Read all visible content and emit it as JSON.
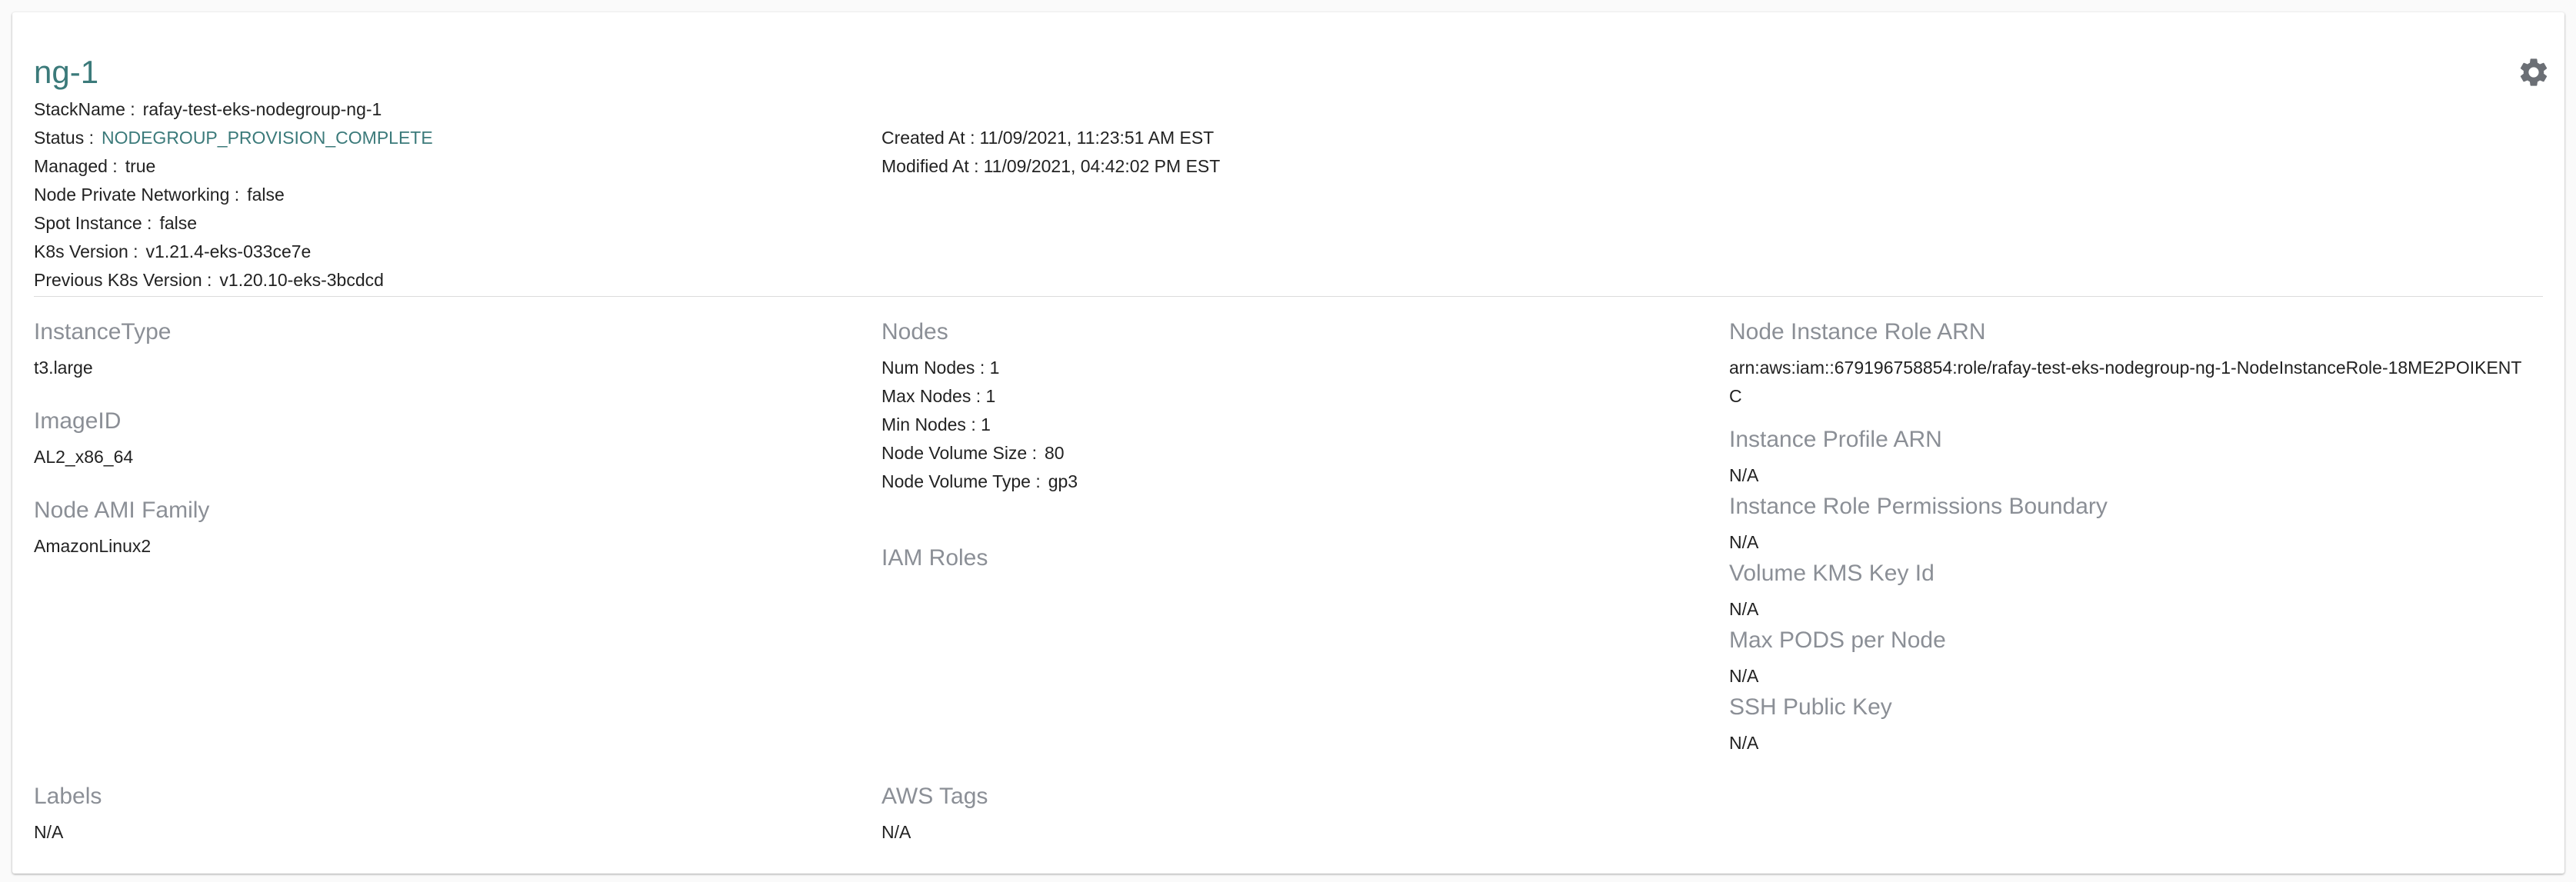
{
  "nodegroup": {
    "name": "ng-1",
    "settings_icon": "gear-icon"
  },
  "info": {
    "stack_name": {
      "label": "StackName :",
      "value": "rafay-test-eks-nodegroup-ng-1"
    },
    "status": {
      "label": "Status :",
      "value": "NODEGROUP_PROVISION_COMPLETE",
      "color": "#3b7a7a"
    },
    "managed": {
      "label": "Managed :",
      "value": "true"
    },
    "node_private_networking": {
      "label": "Node Private Networking :",
      "value": "false"
    },
    "spot_instance": {
      "label": "Spot Instance :",
      "value": "false"
    },
    "k8s_version": {
      "label": "K8s Version :",
      "value": "v1.21.4-eks-033ce7e"
    },
    "previous_k8s_version": {
      "label": "Previous K8s Version :",
      "value": "v1.20.10-eks-3bcdcd"
    },
    "created_at": {
      "label": "Created At :",
      "value": "11/09/2021, 11:23:51 AM EST"
    },
    "modified_at": {
      "label": "Modified At :",
      "value": "11/09/2021, 04:42:02 PM EST"
    }
  },
  "instance_type": {
    "title": "InstanceType",
    "value": "t3.large"
  },
  "image_id": {
    "title": "ImageID",
    "value": "AL2_x86_64"
  },
  "node_ami_family": {
    "title": "Node AMI Family",
    "value": "AmazonLinux2"
  },
  "nodes": {
    "title": "Nodes",
    "num_nodes": {
      "label": "Num Nodes :",
      "value": "1"
    },
    "max_nodes": {
      "label": "Max Nodes :",
      "value": "1"
    },
    "min_nodes": {
      "label": "Min Nodes :",
      "value": "1"
    },
    "node_volume_size": {
      "label": "Node Volume Size :",
      "value": "80"
    },
    "node_volume_type": {
      "label": "Node Volume Type :",
      "value": "gp3"
    }
  },
  "iam_roles": {
    "title": "IAM Roles"
  },
  "node_instance_role_arn": {
    "title": "Node Instance Role ARN",
    "value": "arn:aws:iam::679196758854:role/rafay-test-eks-nodegroup-ng-1-NodeInstanceRole-18ME2POIKENTC"
  },
  "instance_profile_arn": {
    "title": "Instance Profile ARN",
    "value": "N/A"
  },
  "instance_role_permissions_boundary": {
    "title": "Instance Role Permissions Boundary",
    "value": "N/A"
  },
  "volume_kms_key_id": {
    "title": "Volume KMS Key Id",
    "value": "N/A"
  },
  "max_pods_per_node": {
    "title": "Max PODS per Node",
    "value": "N/A"
  },
  "ssh_public_key": {
    "title": "SSH Public Key",
    "value": "N/A"
  },
  "labels": {
    "title": "Labels",
    "value": "N/A"
  },
  "aws_tags": {
    "title": "AWS Tags",
    "value": "N/A"
  }
}
